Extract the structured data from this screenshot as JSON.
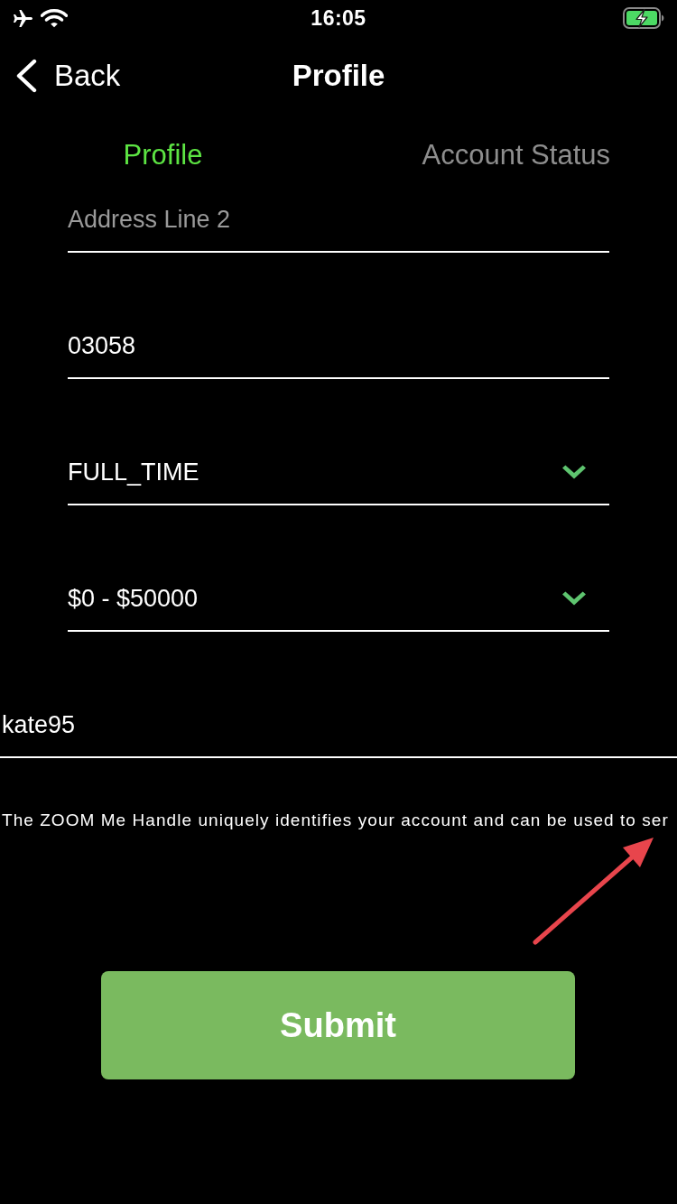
{
  "status_bar": {
    "time": "16:05",
    "airplane_mode": true,
    "charging": true
  },
  "nav": {
    "back_label": "Back",
    "title": "Profile"
  },
  "tabs": [
    {
      "label": "Profile",
      "selected": true
    },
    {
      "label": "Account Status",
      "selected": false
    }
  ],
  "fields": [
    {
      "kind": "text",
      "placeholder": "Address Line 2"
    },
    {
      "kind": "text",
      "value": "03058"
    },
    {
      "kind": "select",
      "value": "FULL_TIME"
    },
    {
      "kind": "select",
      "value": "$0 - $50000"
    }
  ],
  "handle_field": {
    "value": "kate95"
  },
  "helper_text": "The ZOOM Me Handle uniquely identifies your account and can be used to ser",
  "annotation": {
    "kind": "arrow"
  },
  "submit_button": {
    "label": "Submit"
  }
}
